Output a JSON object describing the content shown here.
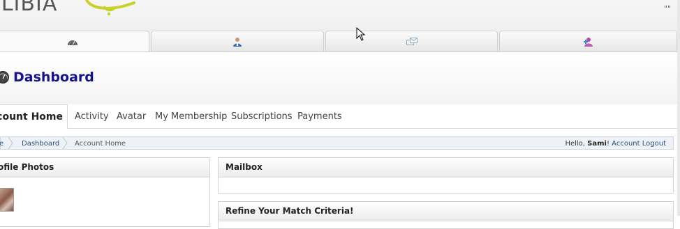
{
  "header": {
    "logo_text": "JLIBIA",
    "corner_mark": "\"\""
  },
  "top_tabs": [
    {
      "name": "dashboard",
      "icon": "dashboard-icon",
      "active": true
    },
    {
      "name": "profile",
      "icon": "user-icon",
      "active": false
    },
    {
      "name": "mail",
      "icon": "mail-icon",
      "active": false
    },
    {
      "name": "search-members",
      "icon": "add-user-icon",
      "active": false
    }
  ],
  "page": {
    "title": "Dashboard",
    "title_color": "#16158e"
  },
  "subnav": {
    "active": "count Home",
    "items": [
      "Activity",
      "Avatar",
      "My Membership",
      "Subscriptions",
      "Payments"
    ]
  },
  "breadcrumb": {
    "items": [
      "e",
      "Dashboard",
      "Account Home"
    ],
    "hello_prefix": "Hello,",
    "user": "Sami",
    "hello_suffix": "!",
    "account_link": "Account",
    "logout_link": "Logout"
  },
  "panels": {
    "photos_title": "ofile Photos",
    "mailbox_title": "Mailbox",
    "refine_title": "Refine Your Match Criteria!"
  }
}
